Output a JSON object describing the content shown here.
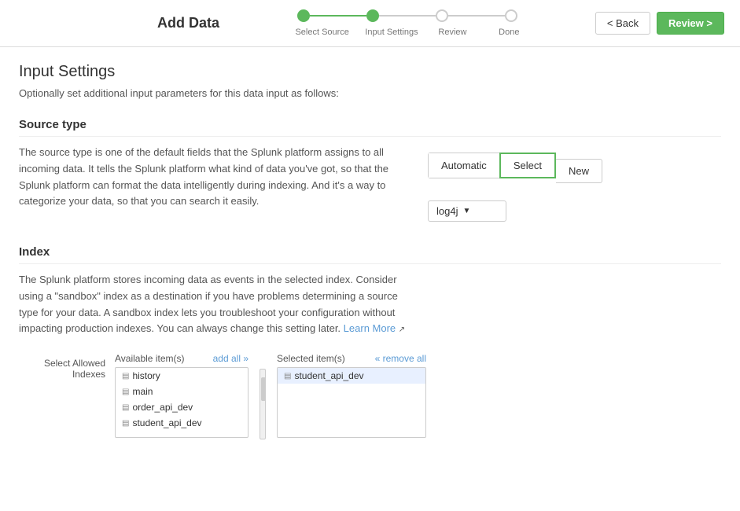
{
  "header": {
    "title": "Add Data",
    "back_label": "< Back",
    "review_label": "Review >"
  },
  "wizard": {
    "steps": [
      {
        "label": "Select Source",
        "state": "completed"
      },
      {
        "label": "Input Settings",
        "state": "completed"
      },
      {
        "label": "Review",
        "state": "inactive"
      },
      {
        "label": "Done",
        "state": "inactive"
      }
    ]
  },
  "page": {
    "heading": "Input Settings",
    "description": "Optionally set additional input parameters for this data input as follows:"
  },
  "source_type": {
    "section_title": "Source type",
    "description": "The source type is one of the default fields that the Splunk platform assigns to all incoming data. It tells the Splunk platform what kind of data you've got, so that the Splunk platform can format the data intelligently during indexing. And it's a way to categorize your data, so that you can search it easily.",
    "buttons": [
      {
        "label": "Automatic",
        "active": false
      },
      {
        "label": "Select",
        "active": true
      },
      {
        "label": "New",
        "active": false
      }
    ],
    "dropdown_value": "log4j"
  },
  "index": {
    "section_title": "Index",
    "description": "The Splunk platform stores incoming data as events in the selected index. Consider using a \"sandbox\" index as a destination if you have problems determining a source type for your data. A sandbox index lets you troubleshoot your configuration without impacting production indexes. You can always change this setting later.",
    "learn_more_label": "Learn More",
    "select_allowed_label": "Select Allowed\nIndexes",
    "available_label": "Available\nitem(s)",
    "add_all_label": "add all »",
    "selected_label": "Selected item(s)",
    "remove_all_label": "« remove all",
    "available_items": [
      {
        "icon": "▤",
        "name": "history"
      },
      {
        "icon": "▤",
        "name": "main"
      },
      {
        "icon": "▤",
        "name": "order_api_dev"
      },
      {
        "icon": "▤",
        "name": "student_api_dev"
      }
    ],
    "selected_items": [
      {
        "icon": "▤",
        "name": "student_api_dev"
      }
    ]
  }
}
